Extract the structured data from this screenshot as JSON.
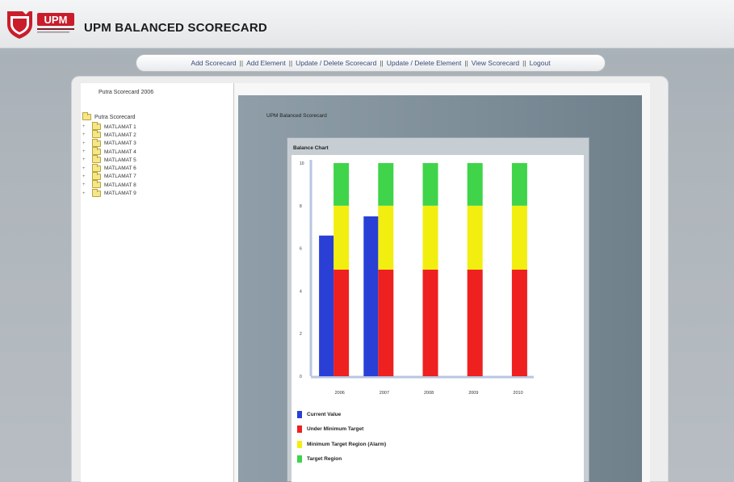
{
  "app": {
    "logo_text": "UPM",
    "title": "UPM BALANCED SCORECARD"
  },
  "nav": {
    "items": [
      "Add Scorecard",
      "Add Element",
      "Update / Delete Scorecard",
      "Update / Delete Element",
      "View Scorecard",
      "Logout"
    ],
    "separator": "||"
  },
  "tree": {
    "header": "Putra Scorecard 2006",
    "root": "Putra Scorecard",
    "items": [
      "MATLAMAT 1",
      "MATLAMAT 2",
      "MATLAMAT 3",
      "MATLAMAT 4",
      "MATLAMAT 5",
      "MATLAMAT 6",
      "MATLAMAT 7",
      "MATLAMAT 8",
      "MATLAMAT 9"
    ]
  },
  "main": {
    "title": "UPM Balanced Scorecard",
    "chart_title": "Balance Chart"
  },
  "colors": {
    "current": "#2a3fd6",
    "under": "#ee2020",
    "minimum": "#f2ee10",
    "target": "#3fd44a"
  },
  "chart_data": {
    "type": "bar",
    "title": "Balance Chart",
    "categories": [
      "2006",
      "2007",
      "2008",
      "2009",
      "2010"
    ],
    "ylim": [
      0,
      10
    ],
    "yticks": [
      "0",
      "2",
      "4",
      "6",
      "8",
      "10"
    ],
    "series": [
      {
        "name": "Current Value",
        "values": [
          6.6,
          7.5,
          null,
          null,
          null
        ]
      },
      {
        "name": "Under Minimum Target",
        "values": [
          5,
          5,
          5,
          5,
          5
        ]
      },
      {
        "name": "Minimum Target Region (Alarm)",
        "values": [
          3,
          3,
          3,
          3,
          3
        ]
      },
      {
        "name": "Target Region",
        "values": [
          2,
          2,
          2,
          2,
          2
        ]
      }
    ],
    "legend": [
      "Current Value",
      "Under Minimum Target",
      "Minimum Target Region (Alarm)",
      "Target Region"
    ],
    "legend_position": "bottom-left",
    "grid": false
  }
}
